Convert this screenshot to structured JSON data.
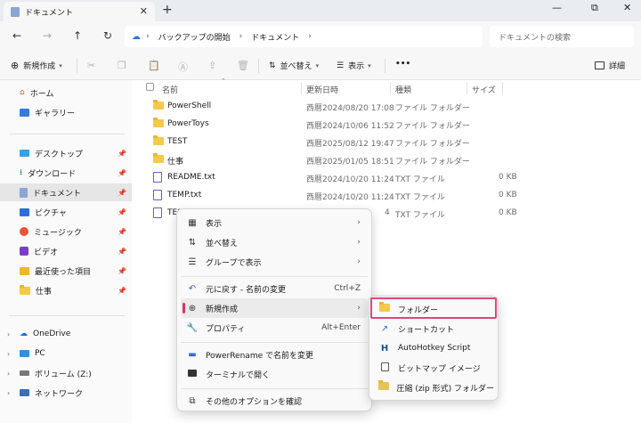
{
  "window": {
    "tab_title": "ドキュメント",
    "new_tab": "+",
    "minimize": "—",
    "maximize": "⧉",
    "close": "✕"
  },
  "nav": {
    "breadcrumbs": [
      "バックアップの開始",
      "ドキュメント"
    ],
    "search_placeholder": "ドキュメントの検索"
  },
  "toolbar": {
    "new_label": "新規作成",
    "sort_label": "並べ替え",
    "view_label": "表示",
    "more_label": "•••",
    "details_label": "詳細"
  },
  "sidebar": {
    "quick": [
      {
        "label": "ホーム",
        "icon": "home-icon"
      },
      {
        "label": "ギャラリー",
        "icon": "gallery-icon"
      }
    ],
    "pinned": [
      {
        "label": "デスクトップ",
        "icon": "desktop-icon"
      },
      {
        "label": "ダウンロード",
        "icon": "download-icon"
      },
      {
        "label": "ドキュメント",
        "icon": "document-icon"
      },
      {
        "label": "ピクチャ",
        "icon": "picture-icon"
      },
      {
        "label": "ミュージック",
        "icon": "music-icon"
      },
      {
        "label": "ビデオ",
        "icon": "video-icon"
      },
      {
        "label": "最近使った項目",
        "icon": "recent-icon"
      },
      {
        "label": "仕事",
        "icon": "folder-icon"
      }
    ],
    "tree": [
      {
        "label": "OneDrive",
        "icon": "cloud-icon"
      },
      {
        "label": "PC",
        "icon": "pc-icon"
      },
      {
        "label": "ボリューム (Z:)",
        "icon": "drive-icon"
      },
      {
        "label": "ネットワーク",
        "icon": "network-icon"
      }
    ]
  },
  "list": {
    "headers": {
      "name": "名前",
      "date": "更新日時",
      "type": "種類",
      "size": "サイズ"
    },
    "rows": [
      {
        "name": "PowerShell",
        "date": "西暦2024/08/20 17:08",
        "type": "ファイル フォルダー",
        "size": "",
        "kind": "folder"
      },
      {
        "name": "PowerToys",
        "date": "西暦2024/10/06 11:52",
        "type": "ファイル フォルダー",
        "size": "",
        "kind": "folder"
      },
      {
        "name": "TEST",
        "date": "西暦2025/08/12 19:47",
        "type": "ファイル フォルダー",
        "size": "",
        "kind": "folder"
      },
      {
        "name": "仕事",
        "date": "西暦2025/01/05 18:51",
        "type": "ファイル フォルダー",
        "size": "",
        "kind": "folder"
      },
      {
        "name": "README.txt",
        "date": "西暦2024/10/20 11:24",
        "type": "TXT ファイル",
        "size": "0 KB",
        "kind": "txt"
      },
      {
        "name": "TEMP.txt",
        "date": "西暦2024/10/20 11:24",
        "type": "TXT ファイル",
        "size": "0 KB",
        "kind": "txt"
      },
      {
        "name": "TEST",
        "date": "4",
        "type": "TXT ファイル",
        "size": "0 KB",
        "kind": "txt"
      }
    ]
  },
  "context_menu": {
    "items": [
      {
        "label": "表示",
        "icon": "grid-icon",
        "shortcut": "",
        "submenu": true
      },
      {
        "label": "並べ替え",
        "icon": "sort-icon",
        "shortcut": "",
        "submenu": true
      },
      {
        "label": "グループで表示",
        "icon": "group-icon",
        "shortcut": "",
        "submenu": true
      },
      {
        "label": "元に戻す - 名前の変更",
        "icon": "undo-icon",
        "shortcut": "Ctrl+Z",
        "submenu": false
      },
      {
        "label": "新規作成",
        "icon": "new-icon",
        "shortcut": "",
        "submenu": true
      },
      {
        "label": "プロパティ",
        "icon": "wrench-icon",
        "shortcut": "Alt+Enter",
        "submenu": false
      },
      {
        "label": "PowerRename で名前を変更",
        "icon": "powerrename-icon",
        "shortcut": "",
        "submenu": false
      },
      {
        "label": "ターミナルで開く",
        "icon": "terminal-icon",
        "shortcut": "",
        "submenu": false
      },
      {
        "label": "その他のオプションを確認",
        "icon": "more-options-icon",
        "shortcut": "",
        "submenu": false
      }
    ]
  },
  "submenu": {
    "items": [
      {
        "label": "フォルダー",
        "icon": "folder-icon"
      },
      {
        "label": "ショートカット",
        "icon": "shortcut-icon"
      },
      {
        "label": "AutoHotkey Script",
        "icon": "ahk-icon"
      },
      {
        "label": "ビットマップ イメージ",
        "icon": "bitmap-icon"
      },
      {
        "label": "圧縮 (zip 形式) フォルダー",
        "icon": "zip-folder-icon"
      }
    ]
  },
  "colors": {
    "accent": "#d6336c",
    "folder": "#f7c948"
  }
}
